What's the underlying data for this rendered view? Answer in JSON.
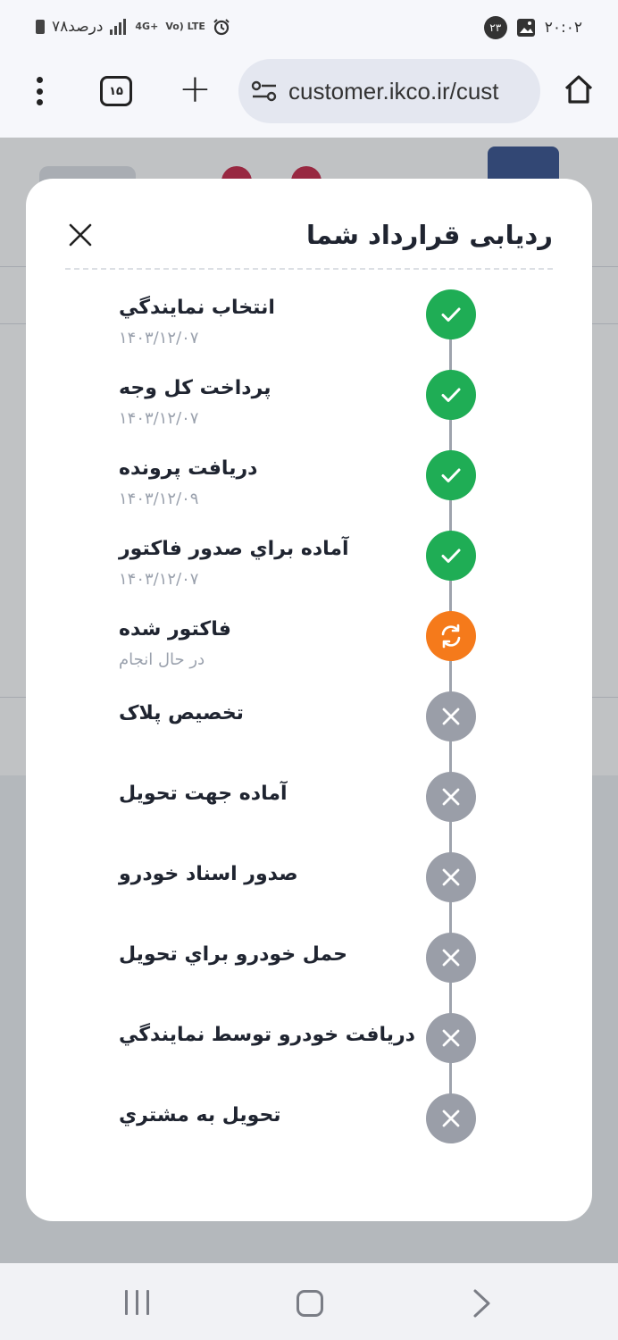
{
  "status_bar": {
    "left_text": "۷۸درصد",
    "network": "4G+",
    "volte": "Vo) LTE",
    "notification_count": "۲۳",
    "time": "۲۰:۰۲"
  },
  "toolbar": {
    "tab_count": "۱۵",
    "url": "customer.ikco.ir/cust"
  },
  "modal": {
    "title": "ردیابی قرارداد شما",
    "steps": [
      {
        "title": "انتخاب نمايندگي",
        "sub": "۱۴۰۳/۱۲/۰۷",
        "status": "done"
      },
      {
        "title": "پرداخت کل وجه",
        "sub": "۱۴۰۳/۱۲/۰۷",
        "status": "done"
      },
      {
        "title": "دریافت پرونده",
        "sub": "۱۴۰۳/۱۲/۰۹",
        "status": "done"
      },
      {
        "title": "آماده براي صدور فاکتور",
        "sub": "۱۴۰۳/۱۲/۰۷",
        "status": "done"
      },
      {
        "title": "فاکتور شده",
        "sub": "در حال انجام",
        "status": "in-progress"
      },
      {
        "title": "تخصیص پلاک",
        "sub": "",
        "status": "pending"
      },
      {
        "title": "آماده جهت تحویل",
        "sub": "",
        "status": "pending"
      },
      {
        "title": "صدور اسناد خودرو",
        "sub": "",
        "status": "pending"
      },
      {
        "title": "حمل خودرو براي تحویل",
        "sub": "",
        "status": "pending"
      },
      {
        "title": "دریافت خودرو توسط نمايندگي",
        "sub": "",
        "status": "pending"
      },
      {
        "title": "تحویل به مشتري",
        "sub": "",
        "status": "pending"
      }
    ]
  },
  "colors": {
    "done": "#1fad55",
    "in_progress": "#f57a1b",
    "pending": "#9a9ea8"
  }
}
